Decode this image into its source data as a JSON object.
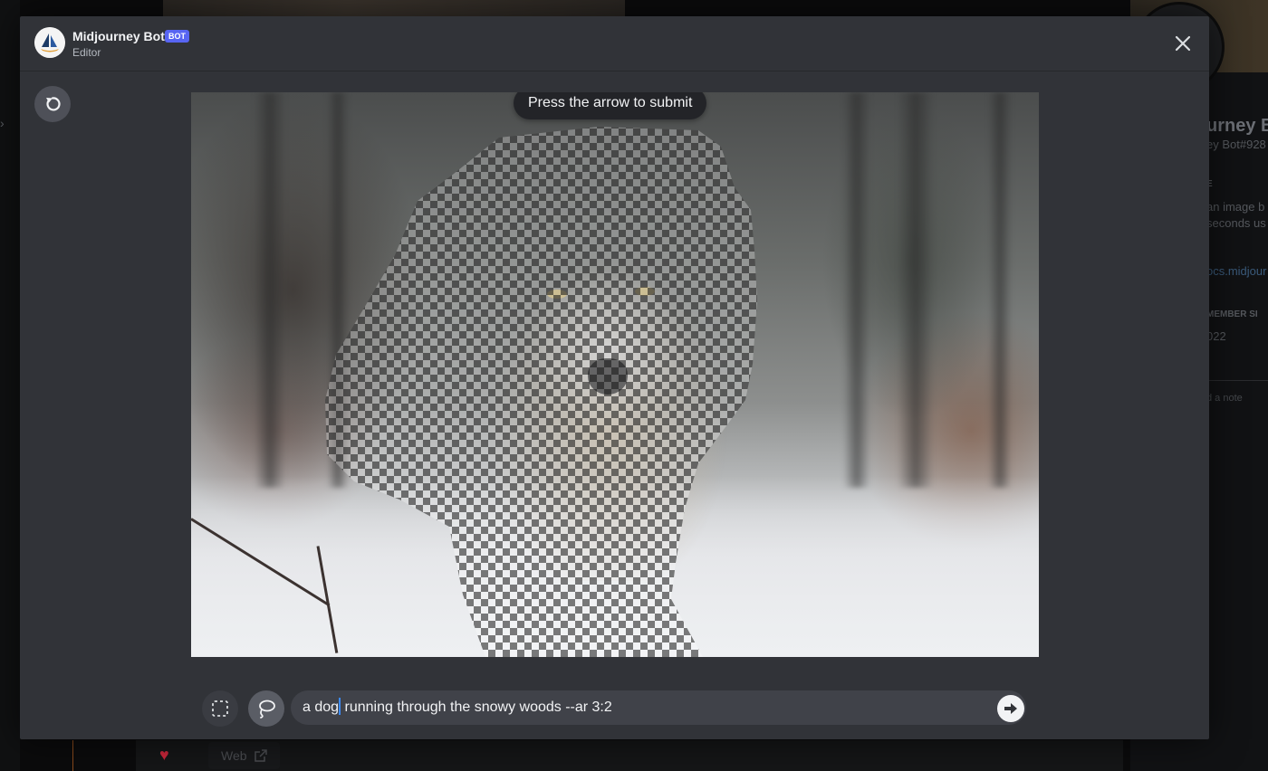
{
  "header": {
    "bot_name": "Midjourney Bot",
    "bot_badge": "BOT",
    "subtitle": "Editor"
  },
  "editor": {
    "tooltip": "Press the arrow to submit",
    "prompt_before_caret": "a dog",
    "prompt_after_caret": " running through the snowy woods --ar 3:2"
  },
  "background": {
    "web_link_label": "Web",
    "profile_name": "urney Bo",
    "profile_tag": "ey Bot#928",
    "about_heading": "E",
    "about_lines": [
      "an image b",
      "seconds us",
      "!"
    ],
    "about_link": "ocs.midjour",
    "member_since_heading": "MEMBER SI",
    "member_since_value": "022",
    "note_placeholder": "d a note"
  },
  "colors": {
    "modal_bg": "#313338",
    "badge": "#5865f2",
    "caret": "#3d8bfd"
  },
  "icons": {
    "close": "close-icon",
    "undo": "undo-icon",
    "rect_select": "rectangle-select-icon",
    "lasso_select": "lasso-select-icon",
    "submit": "arrow-right-icon",
    "web_external": "external-link-icon",
    "heart": "heart-icon"
  }
}
